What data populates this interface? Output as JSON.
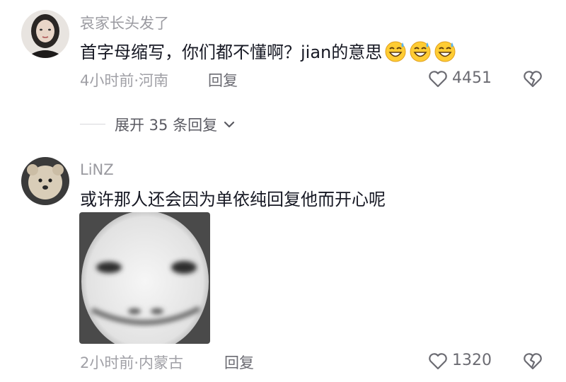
{
  "comments": [
    {
      "username": "哀家长头发了",
      "text": "首字母缩写，你们都不懂啊？jian的意思",
      "emojis": [
        "grinning-sweat-emoji",
        "grinning-sweat-emoji",
        "grinning-sweat-emoji"
      ],
      "time_location": "4小时前·河南",
      "reply_label": "回复",
      "like_count": "4451"
    },
    {
      "username": "LiNZ",
      "text": "或许那人还会因为单依纯回复他而开心呢",
      "attachment": "meme-face-image",
      "time_location": "2小时前·内蒙古",
      "reply_label": "回复",
      "like_count": "1320"
    }
  ],
  "thread": {
    "expand_label": "展开 35 条回复"
  },
  "icons": {
    "like": "heart-outline-icon",
    "dislike": "broken-heart-icon",
    "expand": "chevron-down-icon"
  },
  "colors": {
    "text": "#161823",
    "meta": "#a0a0a6",
    "secondary": "#6b6b72"
  }
}
